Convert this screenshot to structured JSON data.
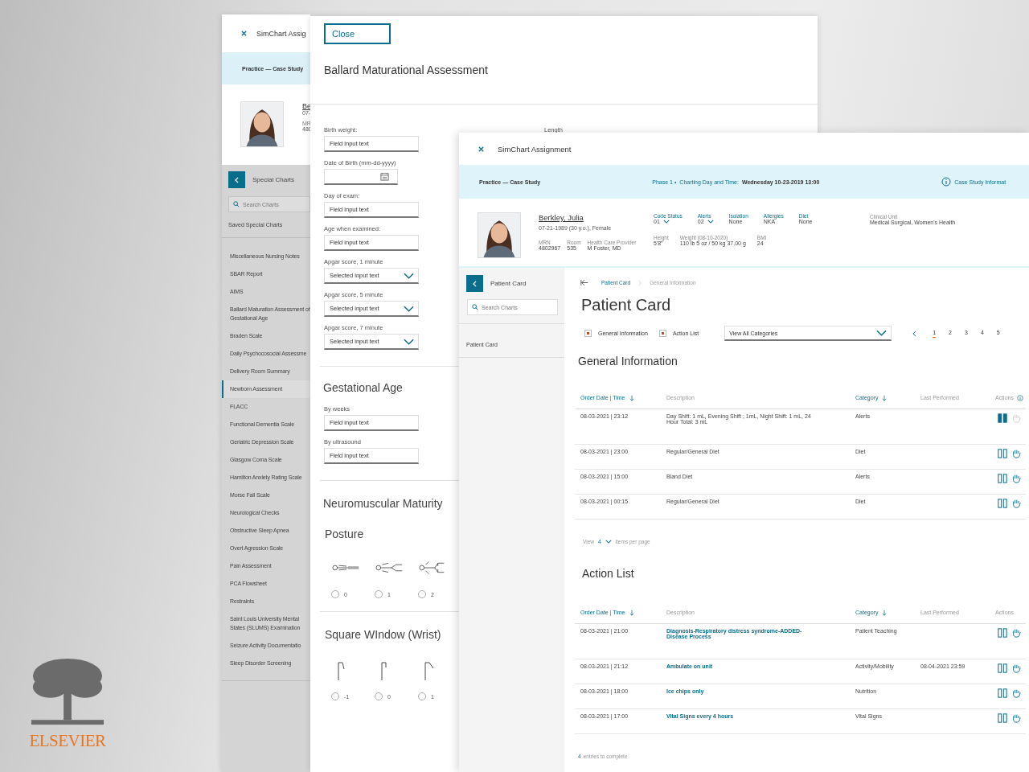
{
  "back_window": {
    "title": "SimChart Assig",
    "banner": "Practice — Case Study",
    "patient": {
      "name": "Be",
      "dob": "07-",
      "mrn_label": "MR",
      "mrn": "480"
    },
    "nav": {
      "title": "Special Charts",
      "search_placeholder": "Search Charts",
      "saved": "Saved Special Charts"
    },
    "items": [
      {
        "label": "Miscellaneous Nursing Notes",
        "selected": false
      },
      {
        "label": "SBAR Report",
        "selected": false
      },
      {
        "label": "AIMS",
        "selected": false
      },
      {
        "label": "Ballard Maturation Assessment of Gestational Age",
        "selected": false
      },
      {
        "label": "Braden Scale",
        "selected": false
      },
      {
        "label": "Daily Psychocosocial Assessme",
        "selected": false
      },
      {
        "label": "Delivery Room Summary",
        "selected": false
      },
      {
        "label": "Newborn Assessment",
        "selected": true
      },
      {
        "label": "FLACC",
        "selected": false
      },
      {
        "label": "Functional Dementia Scale",
        "selected": false
      },
      {
        "label": "Geriatric Depression Scale",
        "selected": false
      },
      {
        "label": "Glasgow Coma Scale",
        "selected": false
      },
      {
        "label": "Hamilton Anxiety Rating Scale",
        "selected": false
      },
      {
        "label": "Morse Fall Scale",
        "selected": false
      },
      {
        "label": "Neurological Checks",
        "selected": false
      },
      {
        "label": "Obstructive Sleep Apnea",
        "selected": false
      },
      {
        "label": "Overt Agression Scale",
        "selected": false
      },
      {
        "label": "Pain Assessment",
        "selected": false
      },
      {
        "label": "PCA Flowsheet",
        "selected": false
      },
      {
        "label": "Restraints",
        "selected": false
      },
      {
        "label": "Saint Louis University Mental States (SLUMS) Examination",
        "selected": false
      },
      {
        "label": "Seizure Activity Documentatio",
        "selected": false
      },
      {
        "label": "Sleep Disorder Screening",
        "selected": false
      }
    ]
  },
  "form_window": {
    "close": "Close",
    "title": "Ballard Maturational Assessment",
    "side_label": "Length",
    "fields": [
      {
        "kind": "text",
        "label": "Birth weight:",
        "value": "Field input text"
      },
      {
        "kind": "date",
        "label": "Date of Birth (mm-dd-yyyy)"
      },
      {
        "kind": "text",
        "label": "Day of exam:",
        "value": "Field input text"
      },
      {
        "kind": "text",
        "label": "Age when examined:",
        "value": "Field input text"
      },
      {
        "kind": "select",
        "label": "Apgar score, 1 minute",
        "value": "Selected input text"
      },
      {
        "kind": "select",
        "label": "Apgar score, 5 minute",
        "value": "Selected input text"
      },
      {
        "kind": "select",
        "label": "Apgar score, 7 minute",
        "value": "Selected input text"
      }
    ],
    "gestational": {
      "title": "Gestational Age",
      "fields": [
        {
          "kind": "text",
          "label": "By weeks",
          "value": "Field input text"
        },
        {
          "kind": "text",
          "label": "By ultrasound",
          "value": "Field input text"
        }
      ]
    },
    "neuromuscular": {
      "title": "Neuromuscular Maturity",
      "groups": [
        {
          "kind": "posture",
          "title": "Posture",
          "options": [
            {
              "label": "0",
              "selected": false
            },
            {
              "label": "1",
              "selected": false
            },
            {
              "label": "2",
              "selected": false
            }
          ]
        },
        {
          "kind": "wrist",
          "title": "Square WIndow (Wrist)",
          "options": [
            {
              "label": "-1",
              "selected": false
            },
            {
              "label": "0",
              "selected": false
            },
            {
              "label": "1",
              "selected": false
            }
          ]
        }
      ]
    }
  },
  "front_window": {
    "title": "SimChart Assignment",
    "banner": {
      "mode": "Practice — Case Study",
      "phase": "Phase 1 •",
      "label": "Charting Day and Time:",
      "datetime": "Wednesday 10-23-2019 13:00",
      "info_link": "Case Study Informat"
    },
    "patient": {
      "name": "Berkley, Julia",
      "details": "07-21-1989 (30 y.o.), Female",
      "ids": [
        {
          "label": "MRN",
          "value": "4802967"
        },
        {
          "label": "Room",
          "value": "535"
        },
        {
          "label": "Health Care Provider",
          "value": "M Foster, MD"
        }
      ],
      "statuses": [
        {
          "label": "Code Status",
          "value": "01",
          "dropdown": true
        },
        {
          "label": "Alerts",
          "value": "02",
          "dropdown": true
        },
        {
          "label": "Isolation",
          "value": "None",
          "dropdown": false
        },
        {
          "label": "Allergies",
          "value": "NKA",
          "dropdown": false
        },
        {
          "label": "Diet",
          "value": "None",
          "dropdown": false
        }
      ],
      "measures": [
        {
          "label": "Height",
          "value": "5'8\""
        },
        {
          "label": "Weight (08-10-2020)",
          "value": "110 lb 5 oz / 50 kg 37.00 g"
        },
        {
          "label": "BMI",
          "value": "24"
        }
      ],
      "clinical_unit": {
        "label": "Clinical Unit",
        "value": "Medical Surgical, Women's Health"
      }
    },
    "sidebar": {
      "title": "Patient Card",
      "search_placeholder": "Search Charts",
      "items": [
        "Patient Card"
      ]
    },
    "breadcrumb": [
      "Patient Card",
      "General Information"
    ],
    "page_title": "Patient Card",
    "filters": [
      {
        "label": "General Information",
        "checked": true
      },
      {
        "label": "Action List",
        "checked": true
      }
    ],
    "category_select": "View All Categories",
    "pages": [
      {
        "label": "1",
        "selected": true
      },
      {
        "label": "2",
        "selected": false
      },
      {
        "label": "3",
        "selected": false
      },
      {
        "label": "4",
        "selected": false
      },
      {
        "label": "5",
        "selected": false
      }
    ],
    "tables": [
      {
        "title": "General Information",
        "links": false,
        "columns": [
          {
            "label": "Order Date | Time",
            "sortable": true
          },
          {
            "label": "Description",
            "sortable": false
          },
          {
            "label": "Category",
            "sortable": true
          },
          {
            "label": "Last Performed",
            "sortable": false
          },
          {
            "label": "Actions",
            "sortable": false
          }
        ],
        "rows": [
          {
            "date": "08-03-2021 | 23:12",
            "description": "Day Shift: 1 mL, Evening Shift ; 1mL, Night Shift: 1 mL, 24 Hour Total: 3 mL",
            "category": "Alerts",
            "held": true
          },
          {
            "date": "08-03-2021 | 23:00",
            "description": "Regular/General Diet",
            "category": "Diet",
            "held": false
          },
          {
            "date": "08-03-2021 | 15:00",
            "description": "Bland Diet",
            "category": "Alerts",
            "held": false
          },
          {
            "date": "08-03-2021 | 00:15",
            "description": "Regular/General Diet",
            "category": "Diet",
            "held": false
          }
        ],
        "pager": {
          "view": "View",
          "count": "4",
          "suffix": "items per page"
        }
      },
      {
        "title": "Action List",
        "links": true,
        "columns": [
          {
            "label": "Order Date | Time",
            "sortable": true
          },
          {
            "label": "Description",
            "sortable": false
          },
          {
            "label": "Category",
            "sortable": true
          },
          {
            "label": "Last Performed",
            "sortable": false
          },
          {
            "label": "Actions",
            "sortable": false
          }
        ],
        "rows": [
          {
            "date": "08-03-2021 | 21:00",
            "description": "Diagnosis-Respiratory distress syndrome-ADDED-Disease Process",
            "category": "Patient Teaching",
            "held": false
          },
          {
            "date": "08-03-2021 | 21:12",
            "description": "Ambulate on unit",
            "category": "Activity/Mobility",
            "last_performed": "08-04-2021  23:59",
            "held": false
          },
          {
            "date": "08-03-2021 | 18:00",
            "description": "Ice chips only",
            "category": "Nutrition",
            "held": false
          },
          {
            "date": "08-03-2021 | 17:00",
            "description": "Vital Signs every 4 hours",
            "category": "Vital Signs",
            "held": false
          }
        ],
        "footer": {
          "count": "4",
          "text": "entries to complete"
        }
      }
    ]
  },
  "logo": {
    "wordmark": "ELSEVIER"
  }
}
